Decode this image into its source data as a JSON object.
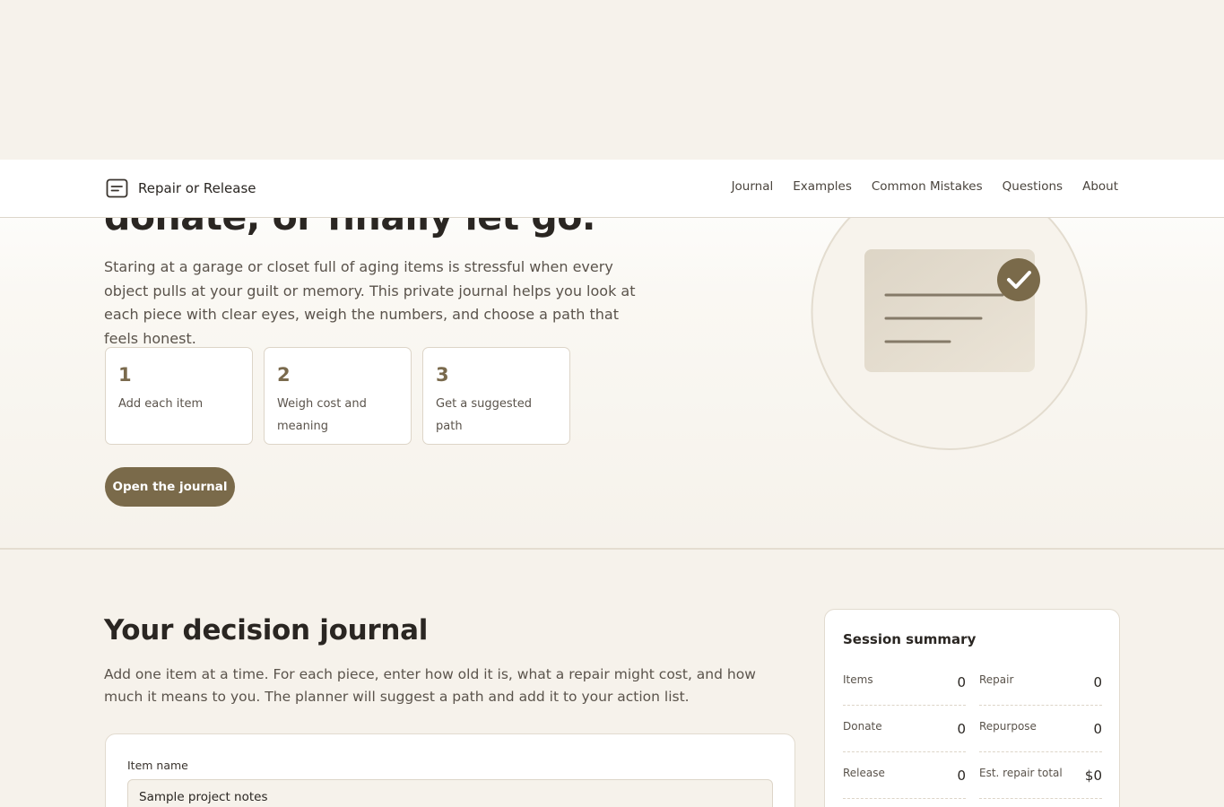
{
  "nav": {
    "brand": "Repair or Release",
    "brand_icon": "notes-icon",
    "links": [
      "Journal",
      "Examples",
      "Common Mistakes",
      "Questions",
      "About"
    ]
  },
  "hero": {
    "title": "donate, or finally let go.",
    "description": "Staring at a garage or closet full of aging items is stressful when every object pulls at your guilt or memory. This private journal helps you look at each piece with clear eyes, weigh the numbers, and choose a path that feels honest.",
    "steps": [
      {
        "number": "1",
        "label": "Add each item"
      },
      {
        "number": "2",
        "label": "Weigh cost and meaning"
      },
      {
        "number": "3",
        "label": "Get a suggested path"
      }
    ],
    "cta_label": "Open the journal",
    "illustration_icon": "checked-note-icon"
  },
  "journal": {
    "title": "Your decision journal",
    "description": "Add one item at a time. For each piece, enter how old it is, what a repair might cost, and how much it means to you. The planner will suggest a path and add it to your action list.",
    "form": {
      "item_name_label": "Item name",
      "item_name_value": "Sample project notes"
    }
  },
  "summary": {
    "title": "Session summary",
    "stats": [
      {
        "label": "Items",
        "value": "0"
      },
      {
        "label": "Repair",
        "value": "0"
      },
      {
        "label": "Donate",
        "value": "0"
      },
      {
        "label": "Repurpose",
        "value": "0"
      },
      {
        "label": "Release",
        "value": "0"
      },
      {
        "label": "Est. repair total",
        "value": "$0"
      }
    ]
  },
  "colors": {
    "accent": "#7a6a4a",
    "background": "#f6f2eb",
    "card": "#ffffff"
  }
}
